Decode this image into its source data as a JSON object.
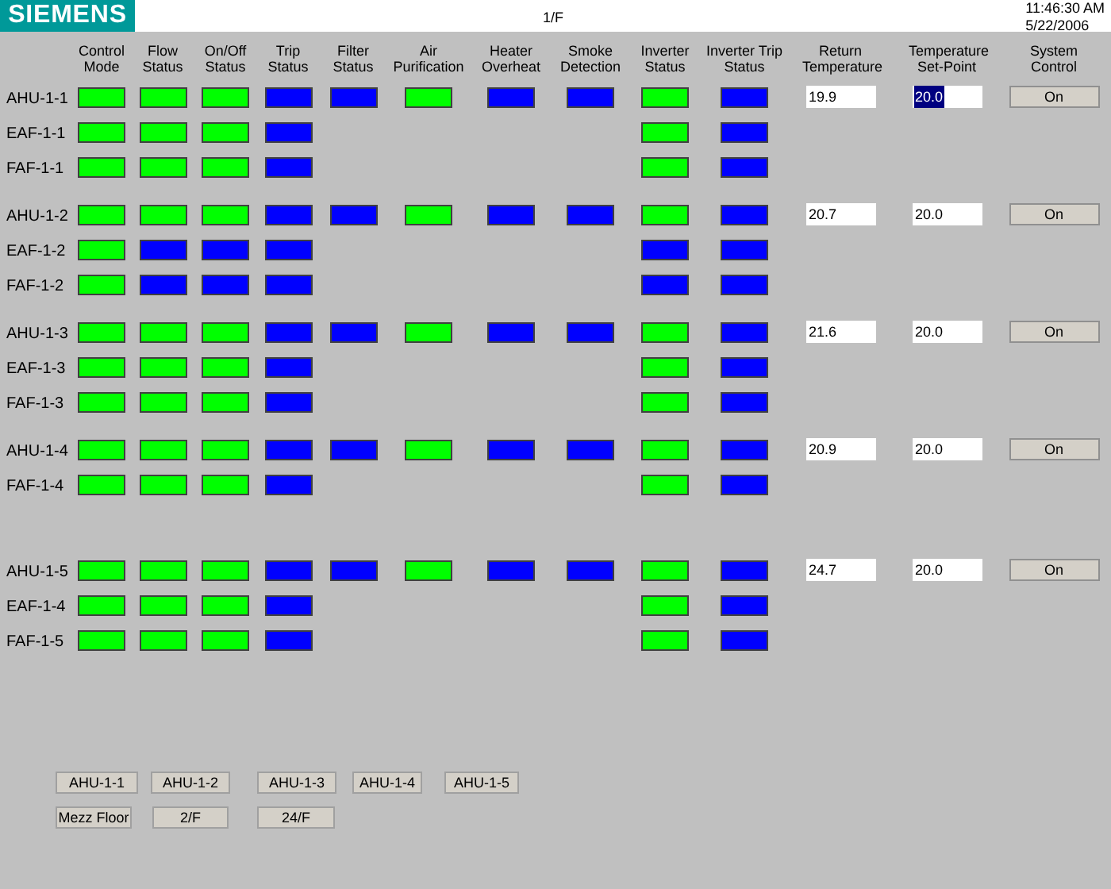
{
  "header": {
    "logo": "SIEMENS",
    "floor": "1/F",
    "time": "11:46:30 AM",
    "date": "5/22/2006"
  },
  "columns": [
    "Control Mode",
    "Flow Status",
    "On/Off Status",
    "Trip Status",
    "Filter Status",
    "Air Purification",
    "Heater Overheat",
    "Smoke Detection",
    "Inverter Status",
    "Inverter Trip Status",
    "Return Temperature",
    "Temperature Set-Point",
    "System Control"
  ],
  "groups": [
    {
      "return_temperature": "19.9",
      "set_point": {
        "value": "20.0",
        "highlighted": true
      },
      "system_control": "On",
      "rows": [
        {
          "label": "AHU-1-1",
          "kind": "ahu",
          "indicators": [
            {
              "on": true
            },
            {
              "on": true
            },
            {
              "on": true
            },
            {
              "on": false
            },
            {
              "on": false
            },
            {
              "on": true
            },
            {
              "on": false
            },
            {
              "on": false
            },
            {
              "on": true
            },
            {
              "on": false
            }
          ]
        },
        {
          "label": "EAF-1-1",
          "kind": "fan",
          "indicators": [
            {
              "on": true
            },
            {
              "on": true
            },
            {
              "on": true
            },
            {
              "on": false
            },
            {
              "on": true
            },
            {
              "on": false
            }
          ]
        },
        {
          "label": "FAF-1-1",
          "kind": "fan",
          "indicators": [
            {
              "on": true
            },
            {
              "on": true
            },
            {
              "on": true
            },
            {
              "on": false
            },
            {
              "on": true
            },
            {
              "on": false
            }
          ]
        }
      ]
    },
    {
      "return_temperature": "20.7",
      "set_point": {
        "value": "20.0",
        "highlighted": false
      },
      "system_control": "On",
      "rows": [
        {
          "label": "AHU-1-2",
          "kind": "ahu",
          "indicators": [
            {
              "on": true
            },
            {
              "on": true
            },
            {
              "on": true
            },
            {
              "on": false
            },
            {
              "on": false
            },
            {
              "on": true
            },
            {
              "on": false
            },
            {
              "on": false
            },
            {
              "on": true
            },
            {
              "on": false
            }
          ]
        },
        {
          "label": "EAF-1-2",
          "kind": "fan",
          "indicators": [
            {
              "on": true
            },
            {
              "on": false
            },
            {
              "on": false
            },
            {
              "on": false
            },
            {
              "on": false
            },
            {
              "on": false
            }
          ]
        },
        {
          "label": "FAF-1-2",
          "kind": "fan",
          "indicators": [
            {
              "on": true
            },
            {
              "on": false
            },
            {
              "on": false
            },
            {
              "on": false
            },
            {
              "on": false
            },
            {
              "on": false
            }
          ]
        }
      ]
    },
    {
      "return_temperature": "21.6",
      "set_point": {
        "value": "20.0",
        "highlighted": false
      },
      "system_control": "On",
      "rows": [
        {
          "label": "AHU-1-3",
          "kind": "ahu",
          "indicators": [
            {
              "on": true
            },
            {
              "on": true
            },
            {
              "on": true
            },
            {
              "on": false
            },
            {
              "on": false
            },
            {
              "on": true
            },
            {
              "on": false
            },
            {
              "on": false
            },
            {
              "on": true
            },
            {
              "on": false
            }
          ]
        },
        {
          "label": "EAF-1-3",
          "kind": "fan",
          "indicators": [
            {
              "on": true
            },
            {
              "on": true
            },
            {
              "on": true
            },
            {
              "on": false
            },
            {
              "on": true
            },
            {
              "on": false
            }
          ]
        },
        {
          "label": "FAF-1-3",
          "kind": "fan",
          "indicators": [
            {
              "on": true
            },
            {
              "on": true
            },
            {
              "on": true
            },
            {
              "on": false
            },
            {
              "on": true
            },
            {
              "on": false
            }
          ]
        }
      ]
    },
    {
      "return_temperature": "20.9",
      "set_point": {
        "value": "20.0",
        "highlighted": false
      },
      "system_control": "On",
      "rows": [
        {
          "label": "AHU-1-4",
          "kind": "ahu",
          "indicators": [
            {
              "on": true
            },
            {
              "on": true
            },
            {
              "on": true
            },
            {
              "on": false
            },
            {
              "on": false
            },
            {
              "on": true
            },
            {
              "on": false
            },
            {
              "on": false
            },
            {
              "on": true
            },
            {
              "on": false
            }
          ]
        },
        {
          "label": "FAF-1-4",
          "kind": "fan",
          "indicators": [
            {
              "on": true
            },
            {
              "on": true
            },
            {
              "on": true
            },
            {
              "on": false
            },
            {
              "on": true
            },
            {
              "on": false
            }
          ]
        }
      ]
    },
    {
      "return_temperature": "24.7",
      "set_point": {
        "value": "20.0",
        "highlighted": false
      },
      "system_control": "On",
      "rows": [
        {
          "label": "AHU-1-5",
          "kind": "ahu",
          "indicators": [
            {
              "on": true
            },
            {
              "on": true
            },
            {
              "on": true
            },
            {
              "on": false
            },
            {
              "on": false
            },
            {
              "on": true
            },
            {
              "on": false
            },
            {
              "on": false
            },
            {
              "on": true
            },
            {
              "on": false
            }
          ]
        },
        {
          "label": "EAF-1-4",
          "kind": "fan",
          "indicators": [
            {
              "on": true
            },
            {
              "on": true
            },
            {
              "on": true
            },
            {
              "on": false
            },
            {
              "on": true
            },
            {
              "on": false
            }
          ]
        },
        {
          "label": "FAF-1-5",
          "kind": "fan",
          "indicators": [
            {
              "on": true
            },
            {
              "on": true
            },
            {
              "on": true
            },
            {
              "on": false
            },
            {
              "on": true
            },
            {
              "on": false
            }
          ]
        }
      ]
    }
  ],
  "nav_buttons": [
    [
      "AHU-1-1",
      "AHU-1-2",
      "AHU-1-3",
      "AHU-1-4",
      "AHU-1-5"
    ],
    [
      "Mezz Floor",
      "2/F",
      "24/F"
    ]
  ]
}
